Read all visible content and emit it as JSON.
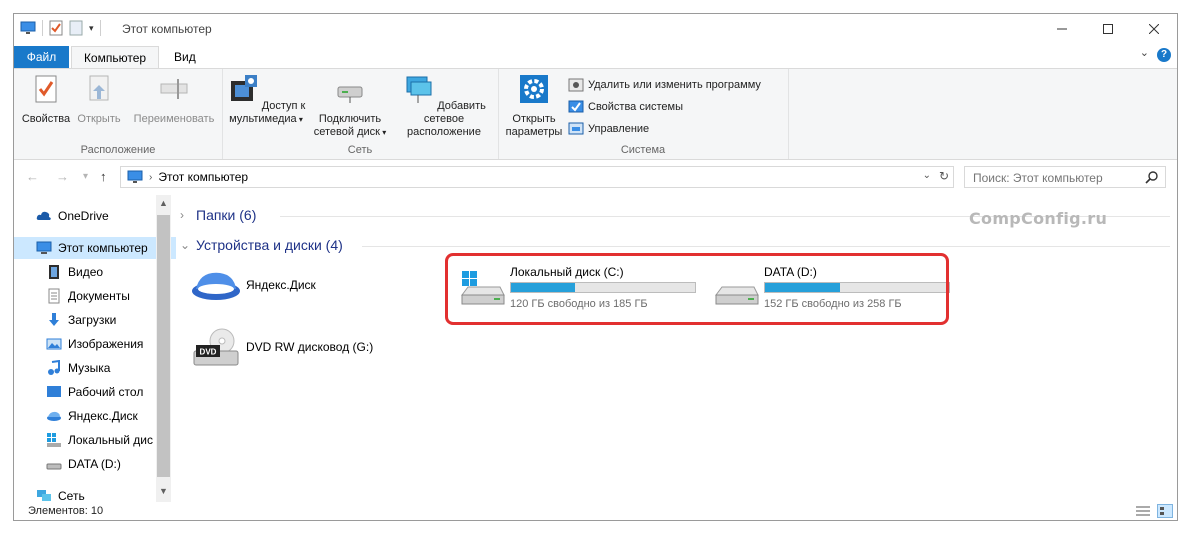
{
  "window": {
    "title": "Этот компьютер"
  },
  "tabs": {
    "file": "Файл",
    "computer": "Компьютер",
    "view": "Вид"
  },
  "ribbon": {
    "location": {
      "label": "Расположение",
      "properties": "Свойства",
      "open": "Открыть",
      "rename": "Переименовать"
    },
    "network": {
      "label": "Сеть",
      "media_line1": "Доступ к",
      "media_line2": "мультимедиа",
      "map_line1": "Подключить",
      "map_line2": "сетевой диск",
      "add_line1": "Добавить сетевое",
      "add_line2": "расположение"
    },
    "system": {
      "label": "Система",
      "open_line1": "Открыть",
      "open_line2": "параметры",
      "uninstall": "Удалить или изменить программу",
      "props": "Свойства системы",
      "manage": "Управление"
    }
  },
  "address": {
    "path": "Этот компьютер"
  },
  "search": {
    "placeholder": "Поиск: Этот компьютер"
  },
  "sidebar": {
    "items": [
      {
        "label": "OneDrive"
      },
      {
        "label": "Этот компьютер"
      },
      {
        "label": "Видео"
      },
      {
        "label": "Документы"
      },
      {
        "label": "Загрузки"
      },
      {
        "label": "Изображения"
      },
      {
        "label": "Музыка"
      },
      {
        "label": "Рабочий стол"
      },
      {
        "label": "Яндекс.Диск"
      },
      {
        "label": "Локальный дис"
      },
      {
        "label": "DATA (D:)"
      },
      {
        "label": "Сеть"
      }
    ]
  },
  "content": {
    "folders_header": "Папки (6)",
    "devices_header": "Устройства и диски (4)",
    "yandex": "Яндекс.Диск",
    "dvd": "DVD RW дисковод (G:)",
    "dvd_badge": "DVD",
    "drives": [
      {
        "name": "Локальный диск (C:)",
        "free": "120 ГБ свободно из 185 ГБ",
        "used_fraction": 0.35
      },
      {
        "name": "DATA (D:)",
        "free": "152 ГБ свободно из 258 ГБ",
        "used_fraction": 0.41
      }
    ]
  },
  "watermark": "CompConfig.ru",
  "status": {
    "count": "Элементов: 10"
  },
  "colors": {
    "accent": "#1979ca",
    "bar": "#26a0da",
    "highlight": "#e23030"
  }
}
